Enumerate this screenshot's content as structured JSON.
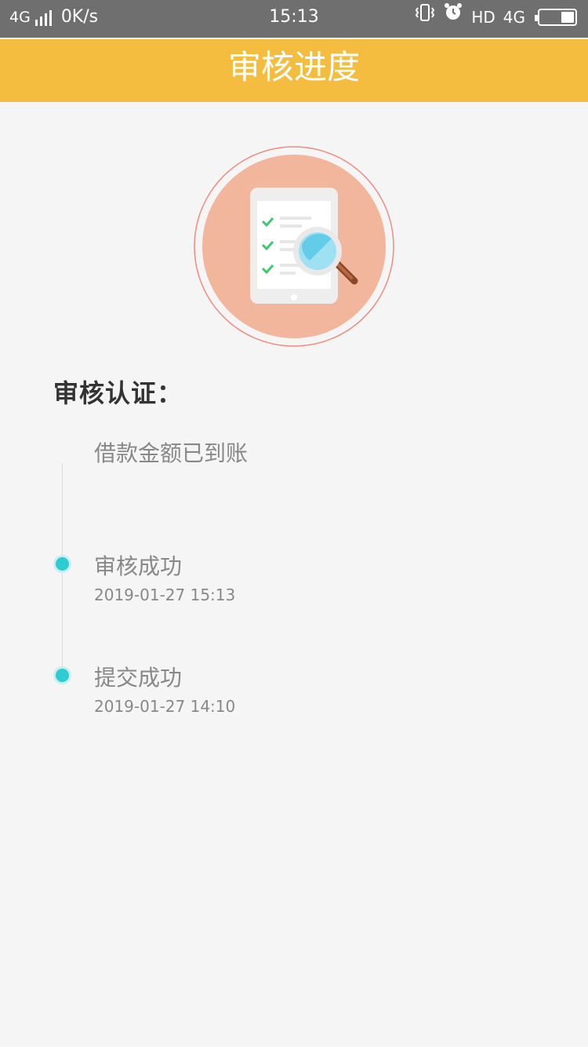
{
  "status_bar": {
    "network": "4G",
    "speed": "0K/s",
    "time": "15:13",
    "hd": "HD",
    "network_right": "4G",
    "icons": [
      "signal-icon",
      "vibrate-icon",
      "alarm-icon",
      "battery-icon"
    ]
  },
  "header": {
    "title": "审核进度",
    "color": "#f5bd40"
  },
  "illustration": {
    "icon": "tablet-checklist-magnifier-icon"
  },
  "section": {
    "title": "审核认证："
  },
  "timeline": {
    "dot_color": "#2ecbd0",
    "steps": [
      {
        "title": "借款金额已到账",
        "time": ""
      },
      {
        "title": "审核成功",
        "time": "2019-01-27  15:13"
      },
      {
        "title": "提交成功",
        "time": "2019-01-27  14:10"
      }
    ]
  }
}
